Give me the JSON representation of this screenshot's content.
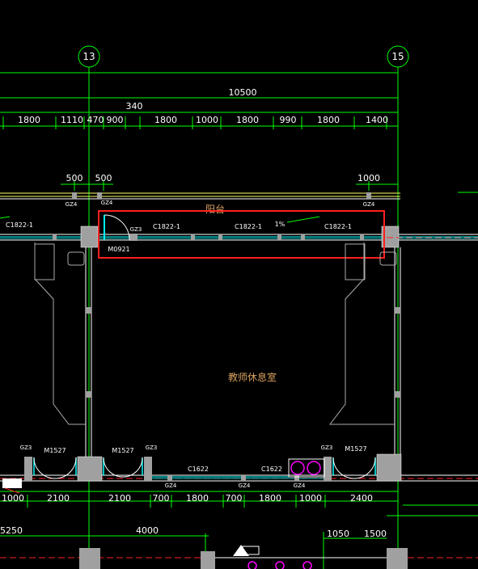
{
  "axes": [
    "13",
    "15"
  ],
  "dims_top_total": "10500",
  "dims_top_sub": "340",
  "dims_top_row": [
    "1800",
    "1110",
    "470",
    "900",
    "1800",
    "1000",
    "1800",
    "990",
    "1800",
    "1400"
  ],
  "dims_mid": [
    "500",
    "500",
    "1000"
  ],
  "balcony_label": "阳台",
  "room_label": "教师休息室",
  "windows_top": [
    "C1822-1",
    "C1822-1",
    "C1822-1",
    "C1822-1"
  ],
  "door_top": "M0921",
  "slope": "1%",
  "windows_bottom": [
    "C1622",
    "C1622"
  ],
  "doors_bottom": [
    "M1527",
    "M1527",
    "M1527"
  ],
  "column_tags": {
    "gz4": "GZ4",
    "gz3": "GZ3"
  },
  "dims_bottom_row": [
    "1000",
    "2100",
    "2100",
    "700",
    "1800",
    "700",
    "1800",
    "1000",
    "2400"
  ],
  "dims_bottom2": [
    "5250",
    "4000",
    "1050",
    "1500"
  ],
  "colors": {
    "background": "#000000",
    "axis": "#00ff00",
    "wall": "#ffffff",
    "column_fill": "#a0a0a0",
    "window": "#00ffff",
    "highlight": "#ff2020",
    "room_text": "#d8a060",
    "dashed_grid": "#ff2020",
    "yellow_wall": "#ffff66",
    "fixture": "#ff00ff"
  }
}
